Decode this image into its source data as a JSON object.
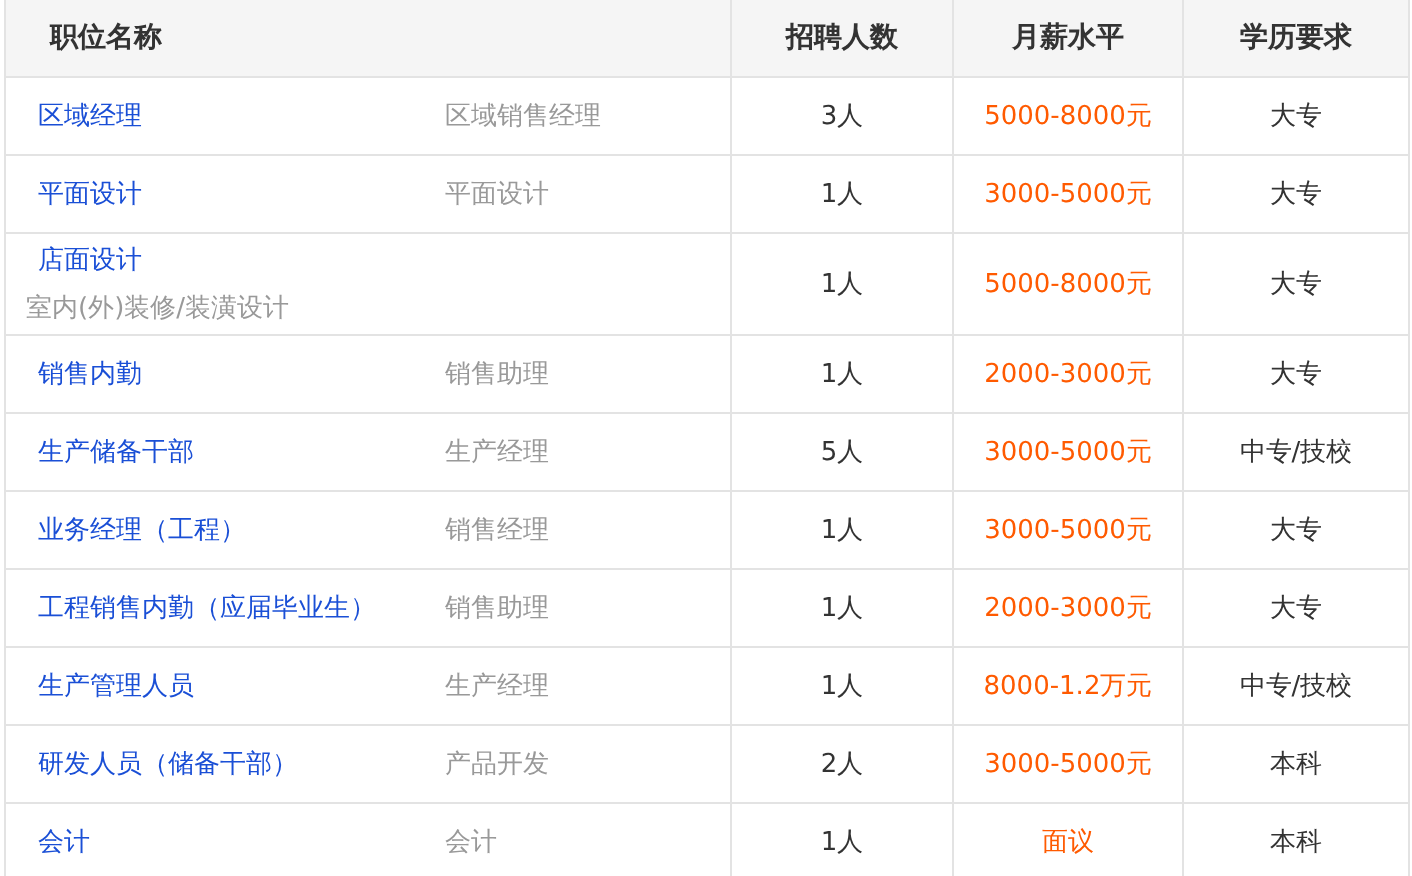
{
  "table": {
    "columns": [
      "职位名称",
      "招聘人数",
      "月薪水平",
      "学历要求"
    ],
    "rows": [
      {
        "title": "区域经理",
        "category": "区域销售经理",
        "count": "3人",
        "salary": "5000-8000元",
        "education": "大专"
      },
      {
        "title": "平面设计",
        "category": "平面设计",
        "count": "1人",
        "salary": "3000-5000元",
        "education": "大专"
      },
      {
        "title": "店面设计",
        "subtitle": "室内(外)装修/装潢设计",
        "count": "1人",
        "salary": "5000-8000元",
        "education": "大专"
      },
      {
        "title": "销售内勤",
        "category": "销售助理",
        "count": "1人",
        "salary": "2000-3000元",
        "education": "大专"
      },
      {
        "title": "生产储备干部",
        "category": "生产经理",
        "count": "5人",
        "salary": "3000-5000元",
        "education": "中专/技校"
      },
      {
        "title": "业务经理（工程）",
        "category": "销售经理",
        "count": "1人",
        "salary": "3000-5000元",
        "education": "大专"
      },
      {
        "title": "工程销售内勤（应届毕业生）",
        "category": "销售助理",
        "count": "1人",
        "salary": "2000-3000元",
        "education": "大专"
      },
      {
        "title": "生产管理人员",
        "category": "生产经理",
        "count": "1人",
        "salary": "8000-1.2万元",
        "education": "中专/技校"
      },
      {
        "title": "研发人员（储备干部）",
        "category": "产品开发",
        "count": "2人",
        "salary": "3000-5000元",
        "education": "本科"
      },
      {
        "title": "会计",
        "category": "会计",
        "count": "1人",
        "salary": "面议",
        "education": "本科"
      }
    ]
  }
}
